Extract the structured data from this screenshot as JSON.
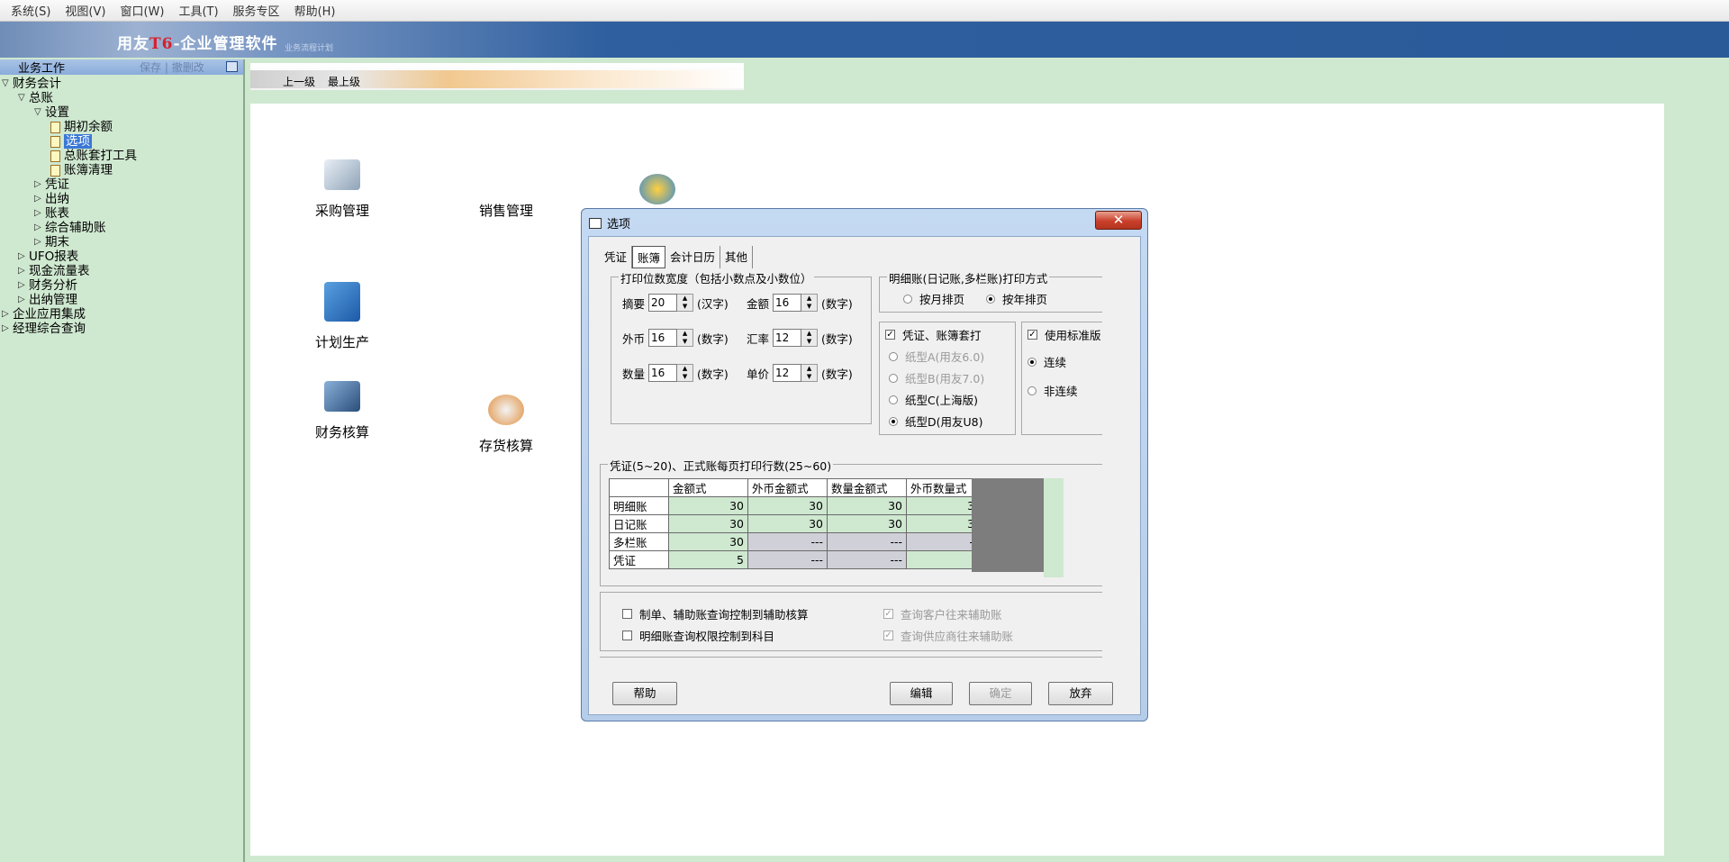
{
  "menu": [
    "系统(S)",
    "视图(V)",
    "窗口(W)",
    "工具(T)",
    "服务专区",
    "帮助(H)"
  ],
  "banner": {
    "title_pre": "用友",
    "title_num": "T6",
    "title_post": "-企业管理软件",
    "subtitle": "业务流程计划"
  },
  "left_panel": {
    "header": "业务工作",
    "save": "保存",
    "undo": "撤删改",
    "tree": [
      {
        "label": "财务会计",
        "level": 0,
        "arrow": "down"
      },
      {
        "label": "总账",
        "level": 1,
        "arrow": "down"
      },
      {
        "label": "设置",
        "level": 2,
        "arrow": "down"
      },
      {
        "label": "期初余额",
        "level": 3,
        "doc": true
      },
      {
        "label": "选项",
        "level": 3,
        "doc": true,
        "selected": true
      },
      {
        "label": "总账套打工具",
        "level": 3,
        "doc": true
      },
      {
        "label": "账簿清理",
        "level": 3,
        "doc": true
      },
      {
        "label": "凭证",
        "level": 2,
        "arrow": "right"
      },
      {
        "label": "出纳",
        "level": 2,
        "arrow": "right"
      },
      {
        "label": "账表",
        "level": 2,
        "arrow": "right"
      },
      {
        "label": "综合辅助账",
        "level": 2,
        "arrow": "right"
      },
      {
        "label": "期末",
        "level": 2,
        "arrow": "right"
      },
      {
        "label": "UFO报表",
        "level": 1,
        "arrow": "right"
      },
      {
        "label": "现金流量表",
        "level": 1,
        "arrow": "right"
      },
      {
        "label": "财务分析",
        "level": 1,
        "arrow": "right"
      },
      {
        "label": "出纳管理",
        "level": 1,
        "arrow": "right"
      },
      {
        "label": "企业应用集成",
        "level": 0,
        "arrow": "right"
      },
      {
        "label": "经理综合查询",
        "level": 0,
        "arrow": "right"
      }
    ]
  },
  "nav": {
    "up": "上一级",
    "top": "最上级"
  },
  "modules": {
    "purchase": "采购管理",
    "sales": "销售管理",
    "plan": "计划生产",
    "finance": "财务核算",
    "inventory": "存货核算"
  },
  "dialog": {
    "title": "选项",
    "close": "✕",
    "tabs": [
      "凭证",
      "账簿",
      "会计日历",
      "其他"
    ],
    "active_tab": "账簿",
    "width_group": {
      "title": "打印位数宽度（包括小数点及小数位）",
      "rows": [
        [
          {
            "label": "摘要",
            "value": "20",
            "unit": "(汉字)"
          },
          {
            "label": "金额",
            "value": "16",
            "unit": "(数字)"
          }
        ],
        [
          {
            "label": "外币",
            "value": "16",
            "unit": "(数字)"
          },
          {
            "label": "汇率",
            "value": "12",
            "unit": "(数字)"
          }
        ],
        [
          {
            "label": "数量",
            "value": "16",
            "unit": "(数字)"
          },
          {
            "label": "单价",
            "value": "12",
            "unit": "(数字)"
          }
        ]
      ]
    },
    "print_mode": {
      "title": "明细账(日记账,多栏账)打印方式",
      "month": "按月排页",
      "year": "按年排页",
      "selected": "year"
    },
    "setprint": {
      "label": "凭证、账簿套打",
      "checked": true,
      "papers": [
        {
          "label": "纸型A(用友6.0)",
          "disabled": true,
          "on": false
        },
        {
          "label": "纸型B(用友7.0)",
          "disabled": true,
          "on": false
        },
        {
          "label": "纸型C(上海版)",
          "disabled": false,
          "on": false
        },
        {
          "label": "纸型D(用友U8)",
          "disabled": false,
          "on": true
        }
      ]
    },
    "standard": {
      "label": "使用标准版",
      "checked": true,
      "continuous": "连续",
      "noncontinuous": "非连续",
      "selected": "continuous"
    },
    "rows_group": {
      "title": "凭证(5~20)、正式账每页打印行数(25~60)",
      "columns": [
        "金额式",
        "外币金额式",
        "数量金额式",
        "外币数量式"
      ],
      "rows": [
        {
          "name": "明细账",
          "cells": [
            {
              "v": "30",
              "ok": true
            },
            {
              "v": "30",
              "ok": true
            },
            {
              "v": "30",
              "ok": true
            },
            {
              "v": "30",
              "ok": true
            }
          ]
        },
        {
          "name": "日记账",
          "cells": [
            {
              "v": "30",
              "ok": true
            },
            {
              "v": "30",
              "ok": true
            },
            {
              "v": "30",
              "ok": true
            },
            {
              "v": "30",
              "ok": true
            }
          ]
        },
        {
          "name": "多栏账",
          "cells": [
            {
              "v": "30",
              "ok": true
            },
            {
              "v": "---",
              "ok": false
            },
            {
              "v": "---",
              "ok": false
            },
            {
              "v": "---",
              "ok": false
            }
          ]
        },
        {
          "name": "凭证",
          "cells": [
            {
              "v": "5",
              "ok": true
            },
            {
              "v": "---",
              "ok": false
            },
            {
              "v": "---",
              "ok": false
            },
            {
              "v": "5",
              "ok": true
            }
          ]
        }
      ]
    },
    "checks": {
      "c1": "制单、辅助账查询控制到辅助核算",
      "c2": "明细账查询权限控制到科目",
      "c3": "查询客户往来辅助账",
      "c4": "查询供应商往来辅助账"
    },
    "buttons": {
      "help": "帮助",
      "edit": "编辑",
      "ok": "确定",
      "cancel": "放弃"
    }
  }
}
